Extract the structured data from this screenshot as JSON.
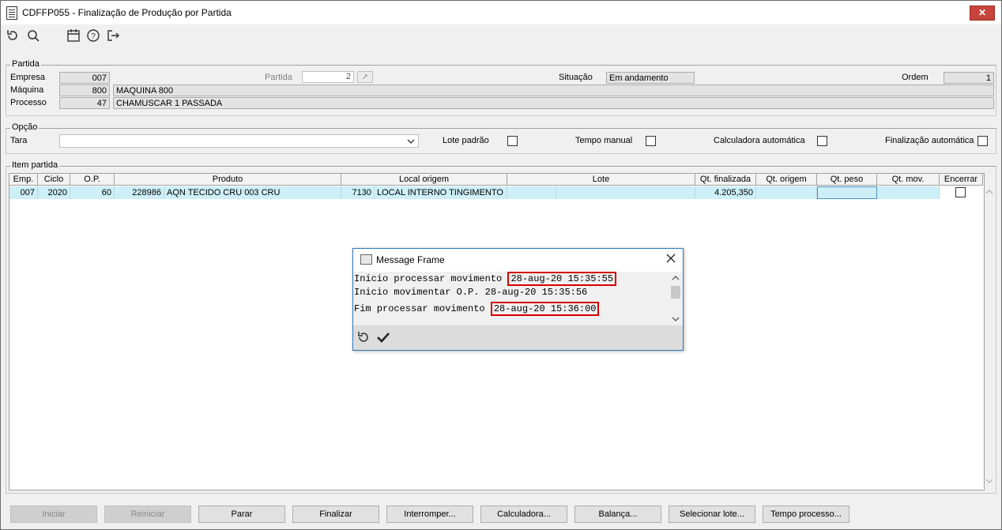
{
  "window": {
    "title": "CDFFP055 - Finalização de Produção por Partida",
    "close_glyph": "✕"
  },
  "toolbar": {
    "icons": [
      "refresh-icon",
      "search-icon",
      "calendar-icon",
      "help-icon",
      "exit-icon"
    ]
  },
  "partida": {
    "group_label": "Partida",
    "empresa_label": "Empresa",
    "empresa_value": "007",
    "maquina_label": "Máquina",
    "maquina_value": "800",
    "maquina_desc": "MAQUINA 800",
    "processo_label": "Processo",
    "processo_value": "47",
    "processo_desc": "CHAMUSCAR 1 PASSADA",
    "partida_label": "Partida",
    "partida_value": "2",
    "situacao_label": "Situação",
    "situacao_value": "Em andamento",
    "ordem_label": "Ordem",
    "ordem_value": "1"
  },
  "opcao": {
    "group_label": "Opção",
    "tara_label": "Tara",
    "tara_value": "",
    "lote_padrao_label": "Lote padrão",
    "tempo_manual_label": "Tempo manual",
    "calculadora_label": "Calculadora automática",
    "finalizacao_label": "Finalização automática"
  },
  "item_partida": {
    "group_label": "Item partida",
    "columns": [
      "Emp.",
      "Ciclo",
      "O.P.",
      "Produto",
      "Local origem",
      "Lote",
      "Qt. finalizada",
      "Qt. origem",
      "Qt. peso",
      "Qt. mov.",
      "Encerrar"
    ],
    "row": {
      "emp": "007",
      "ciclo": "2020",
      "op": "60",
      "produto_code": "228986",
      "produto_desc": "AQN TECIDO CRU 003 CRU",
      "local_code": "7130",
      "local_desc": "LOCAL INTERNO TINGIMENTO",
      "lote": "",
      "qt_finalizada": "4.205,350",
      "qt_origem": "",
      "qt_peso": "",
      "qt_mov": ""
    }
  },
  "dialog": {
    "title": "Message Frame",
    "line1_text": "Inicio processar movimento",
    "line1_time": "28-aug-20 15:35:55",
    "line2": "Inicio movimentar O.P. 28-aug-20 15:35:56",
    "line3_text": "Fim processar movimento",
    "line3_time": "28-aug-20 15:36:00"
  },
  "buttons": {
    "iniciar": "Iniciar",
    "reiniciar": "Reiniciar",
    "parar": "Parar",
    "finalizar": "Finalizar",
    "interromper": "Interromper...",
    "calculadora": "Calculadora...",
    "balanca": "Balança...",
    "selecionar_lote": "Selecionar lote...",
    "tempo_processo": "Tempo processo..."
  }
}
